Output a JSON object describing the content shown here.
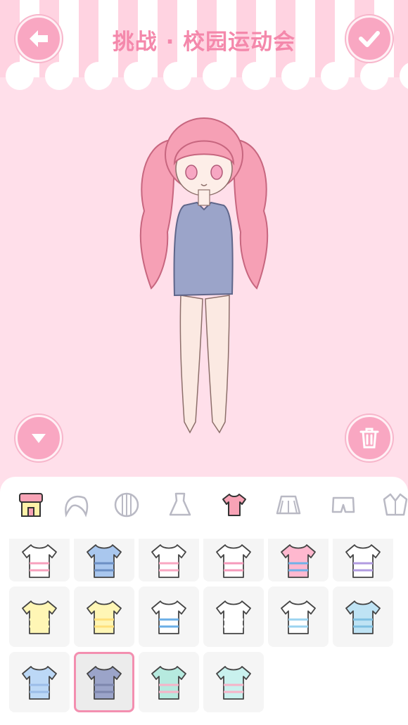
{
  "header": {
    "title": "挑战 · 校园运动会"
  },
  "icons": {
    "back": "arrow-left-icon",
    "confirm": "checkmark-icon",
    "collapse": "triangle-down-icon",
    "delete": "trash-icon"
  },
  "colors": {
    "accent": "#f9a7c2",
    "title": "#f488ab",
    "background": "#ffdfea",
    "selected_border": "#f38fb0"
  },
  "tabs": [
    "shop-icon",
    "hair-front-icon",
    "hair-back-icon",
    "dress-icon",
    "top-icon",
    "skirt-icon",
    "shorts-icon",
    "jacket-icon"
  ],
  "selected_tab": "top-icon",
  "items": [
    {
      "name": "white-tshirt-heart",
      "color": "#ffffff",
      "accent": "#f7a0bd"
    },
    {
      "name": "blue-button-shirt",
      "color": "#a9c7ee",
      "accent": "#6c8fc4"
    },
    {
      "name": "white-ruffle-tshirt",
      "color": "#ffffff",
      "accent": "#f9a7c2"
    },
    {
      "name": "white-text-tshirt",
      "color": "#ffffff",
      "accent": "#f59abb"
    },
    {
      "name": "pink-heart-tank",
      "color": "#ffb8cf",
      "accent": "#6fb1e8"
    },
    {
      "name": "lace-corset-top",
      "color": "#ffffff",
      "accent": "#b19be0"
    },
    {
      "name": "yellow-tshirt",
      "color": "#fff6b5",
      "accent": "#fff6b5"
    },
    {
      "name": "yellow-striped-tshirt",
      "color": "#fff6b5",
      "accent": "#ffe07a"
    },
    {
      "name": "blue-striped-tshirt",
      "color": "#ffffff",
      "accent": "#6aaee6"
    },
    {
      "name": "white-offshoulder-top",
      "color": "#ffffff",
      "accent": "#ffffff"
    },
    {
      "name": "white-bow-blouse",
      "color": "#ffffff",
      "accent": "#9bd3f0"
    },
    {
      "name": "blue-halter-top",
      "color": "#bfe3f4",
      "accent": "#7fc0e2"
    },
    {
      "name": "blue-lace-camisole",
      "color": "#bcd8f6",
      "accent": "#9bbde8"
    },
    {
      "name": "gray-long-shirt",
      "color": "#9ba4c9",
      "accent": "#7d86ad"
    },
    {
      "name": "mint-bear-hoodie",
      "color": "#b6eadf",
      "accent": "#f7b3c8"
    },
    {
      "name": "mint-collar-sweater",
      "color": "#c9f1ee",
      "accent": "#f7b3c8"
    }
  ],
  "selected_item": 13
}
